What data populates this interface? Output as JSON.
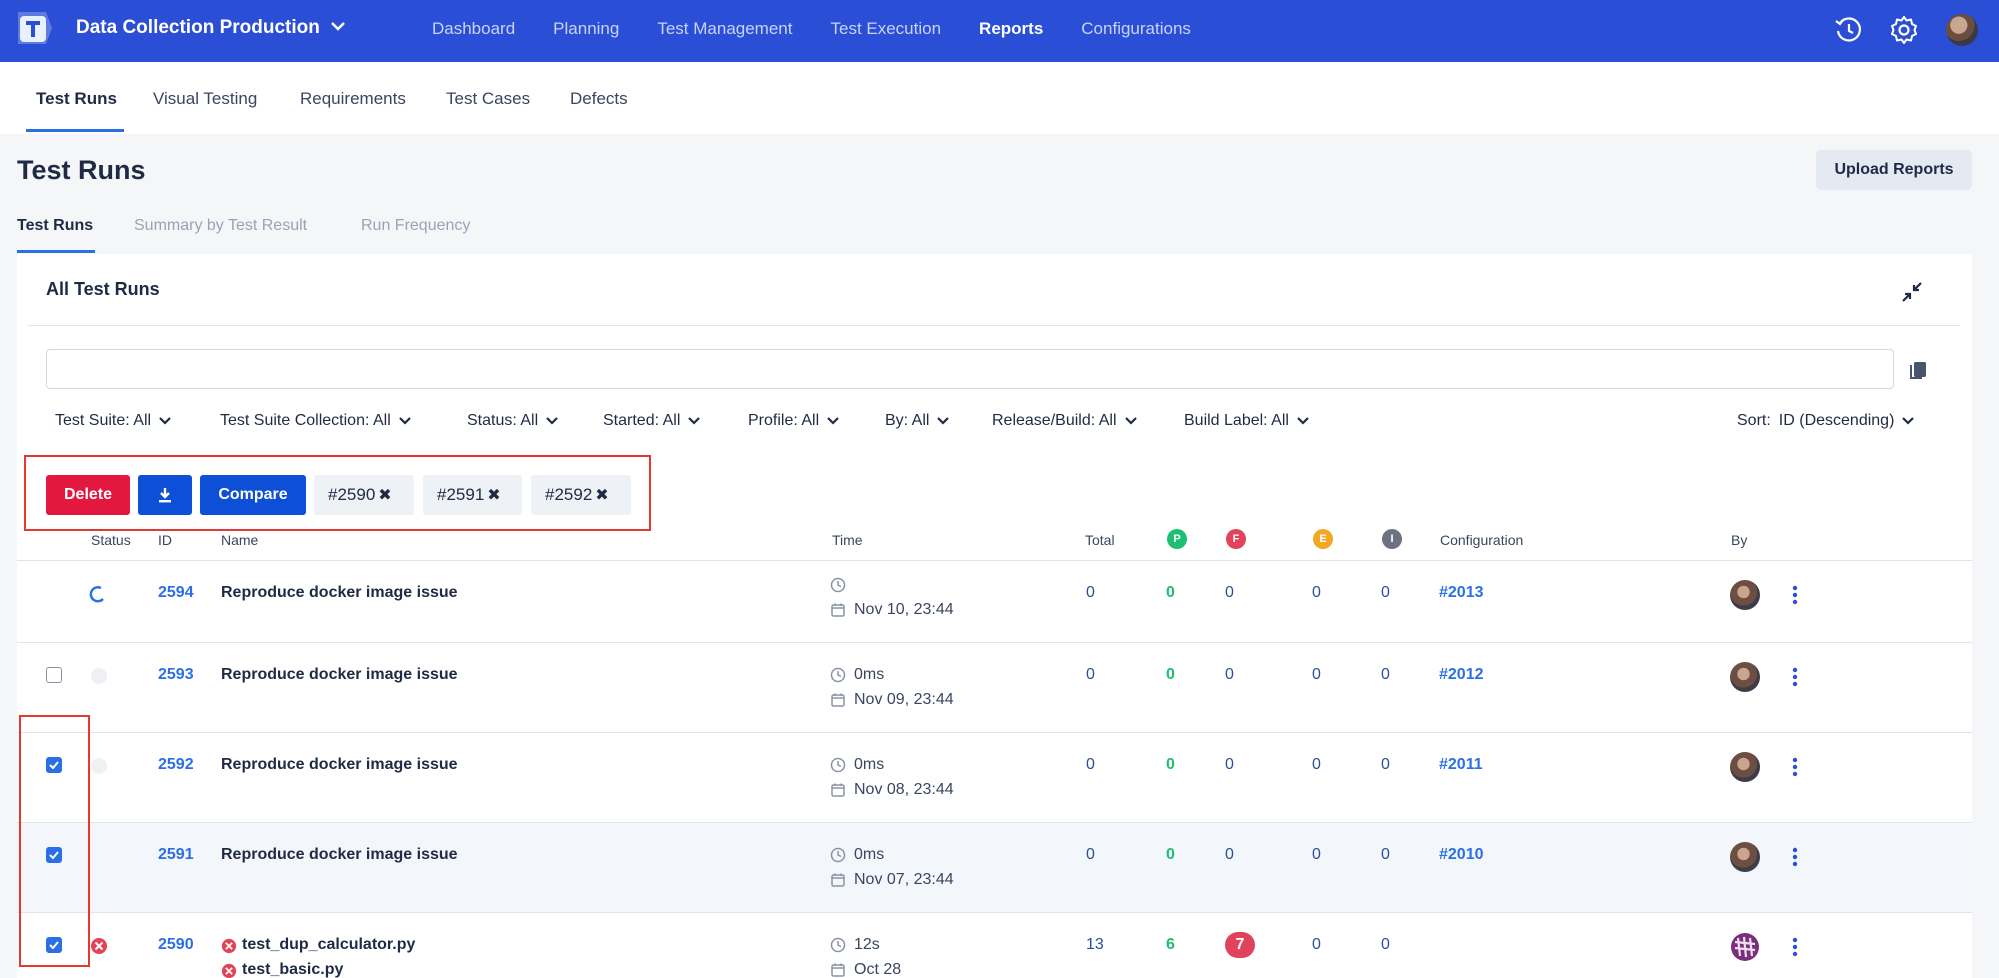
{
  "topbar": {
    "project": "Data Collection Production",
    "nav": [
      "Dashboard",
      "Planning",
      "Test Management",
      "Test Execution",
      "Reports",
      "Configurations"
    ],
    "active_nav": "Reports"
  },
  "subnav": {
    "items": [
      "Test Runs",
      "Visual Testing",
      "Requirements",
      "Test Cases",
      "Defects"
    ],
    "active": "Test Runs"
  },
  "page": {
    "title": "Test Runs",
    "upload_label": "Upload Reports",
    "tabs": [
      "Test Runs",
      "Summary by Test Result",
      "Run Frequency"
    ]
  },
  "panel": {
    "title": "All Test Runs",
    "search_value": "",
    "filters": [
      "Test Suite: All",
      "Test Suite Collection: All",
      "Status: All",
      "Started: All",
      "Profile: All",
      "By: All",
      "Release/Build: All",
      "Build Label: All"
    ],
    "sort_label": "Sort:",
    "sort_value": "ID (Descending)"
  },
  "bulk": {
    "delete_label": "Delete",
    "compare_label": "Compare",
    "chips": [
      "#2590",
      "#2591",
      "#2592"
    ],
    "remove_glyph": "✖"
  },
  "table": {
    "headers": {
      "status": "Status",
      "id": "ID",
      "name": "Name",
      "time": "Time",
      "total": "Total",
      "passed": "P",
      "failed": "F",
      "error": "E",
      "incomplete": "I",
      "configuration": "Configuration",
      "by": "By"
    },
    "rows": [
      {
        "id": "2594",
        "name": "Reproduce docker image issue",
        "duration": "",
        "date": "Nov 10, 23:44",
        "total": "0",
        "passed": "0",
        "failed": "0",
        "error": "0",
        "incomplete": "0",
        "configuration": "#2013"
      },
      {
        "id": "2593",
        "name": "Reproduce docker image issue",
        "duration": "0ms",
        "date": "Nov 09, 23:44",
        "total": "0",
        "passed": "0",
        "failed": "0",
        "error": "0",
        "incomplete": "0",
        "configuration": "#2012"
      },
      {
        "id": "2592",
        "name": "Reproduce docker image issue",
        "duration": "0ms",
        "date": "Nov 08, 23:44",
        "total": "0",
        "passed": "0",
        "failed": "0",
        "error": "0",
        "incomplete": "0",
        "configuration": "#2011"
      },
      {
        "id": "2591",
        "name": "Reproduce docker image issue",
        "duration": "0ms",
        "date": "Nov 07, 23:44",
        "total": "0",
        "passed": "0",
        "failed": "0",
        "error": "0",
        "incomplete": "0",
        "configuration": "#2010"
      },
      {
        "id": "2590",
        "name": "test_dup_calculator.py",
        "name2": "test_basic.py",
        "duration": "12s",
        "date": "Oct 28",
        "total": "13",
        "passed": "6",
        "failed": "7",
        "error": "0",
        "incomplete": "0",
        "configuration": ""
      }
    ]
  },
  "colors": {
    "topbar": "#2a4fd6",
    "accent": "#2a6fe6",
    "danger": "#e3183f",
    "primary": "#0d4fd6",
    "passed": "#1dbf73",
    "failed": "#e1435a",
    "error": "#f5a623",
    "incomplete": "#6b7280"
  }
}
